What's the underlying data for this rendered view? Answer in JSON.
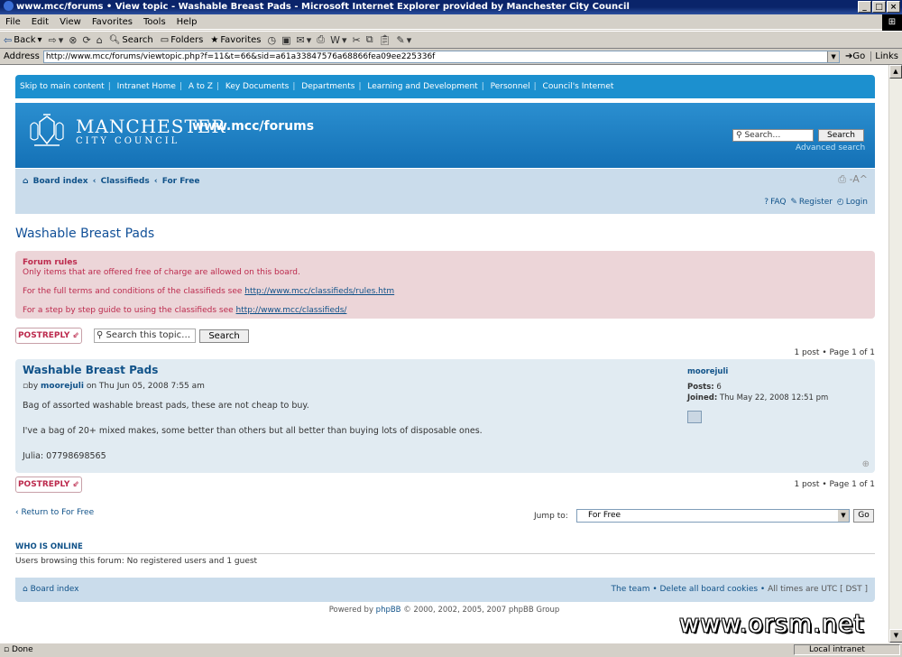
{
  "window": {
    "title": "www.mcc/forums • View topic - Washable Breast Pads - Microsoft Internet Explorer provided by Manchester City Council",
    "minimize": "_",
    "maximize": "□",
    "close": "×"
  },
  "menu": [
    "File",
    "Edit",
    "View",
    "Favorites",
    "Tools",
    "Help"
  ],
  "toolbar": {
    "back": "Back",
    "search": "Search",
    "folders": "Folders",
    "favorites": "Favorites"
  },
  "address": {
    "label": "Address",
    "url": "http://www.mcc/forums/viewtopic.php?f=11&t=66&sid=a61a33847576a68866fea09ee225336f",
    "go": "Go",
    "links": "Links"
  },
  "status": {
    "left": "Done",
    "zone": "Local intranet"
  },
  "topnav": [
    "Skip to main content",
    "Intranet Home",
    "A to Z",
    "Key Documents",
    "Departments",
    "Learning and Development",
    "Personnel",
    "Council's Internet"
  ],
  "header": {
    "logo_line1": "MANCHESTER",
    "logo_line2": "CITY COUNCIL",
    "site_title": "www.mcc/forums",
    "search_placeholder": "Search…",
    "search_button": "Search",
    "advanced_search": "Advanced search"
  },
  "navbar": {
    "crumbs": [
      "Board index",
      "Classifieds",
      "For Free"
    ],
    "faq": "FAQ",
    "register": "Register",
    "login": "Login"
  },
  "page": {
    "title": "Washable Breast Pads"
  },
  "rules": {
    "title": "Forum rules",
    "line1": "Only items that are offered free of charge are allowed on this board.",
    "line2": "For the full terms and conditions of the classifieds see",
    "link2": "http://www.mcc/classifieds/rules.htm",
    "line3": "For a step by step guide to using the classifieds see",
    "link3": "http://www.mcc/classifieds/"
  },
  "actions": {
    "post_reply": "POSTREPLY",
    "search_topic_placeholder": "Search this topic…",
    "search_button": "Search",
    "pagination": "1 post • Page 1 of 1"
  },
  "post": {
    "title": "Washable Breast Pads",
    "by": "by",
    "author": "moorejuli",
    "date": "on Thu Jun 05, 2008 7:55 am",
    "body": [
      "Bag of assorted washable breast pads, these are not cheap to buy.",
      "I've a bag of 20+ mixed makes, some better than others but all better than buying lots of disposable ones.",
      "Julia: 07798698565"
    ],
    "profile_name": "moorejuli",
    "posts_label": "Posts:",
    "posts_value": "6",
    "joined_label": "Joined:",
    "joined_value": "Thu May 22, 2008 12:51 pm"
  },
  "bottom": {
    "return_link": "Return to For Free",
    "jump_label": "Jump to:",
    "jump_value": "For Free",
    "go": "Go"
  },
  "who": {
    "title": "WHO IS ONLINE",
    "text": "Users browsing this forum: No registered users and 1 guest"
  },
  "footer": {
    "board_index": "Board index",
    "team": "The team",
    "delete_cookies": "Delete all board cookies",
    "times": "All times are UTC [ DST ]",
    "powered_prefix": "Powered by",
    "powered_link": "phpBB",
    "powered_suffix": "© 2000, 2002, 2005, 2007 phpBB Group"
  },
  "watermark": "www.orsm.net"
}
